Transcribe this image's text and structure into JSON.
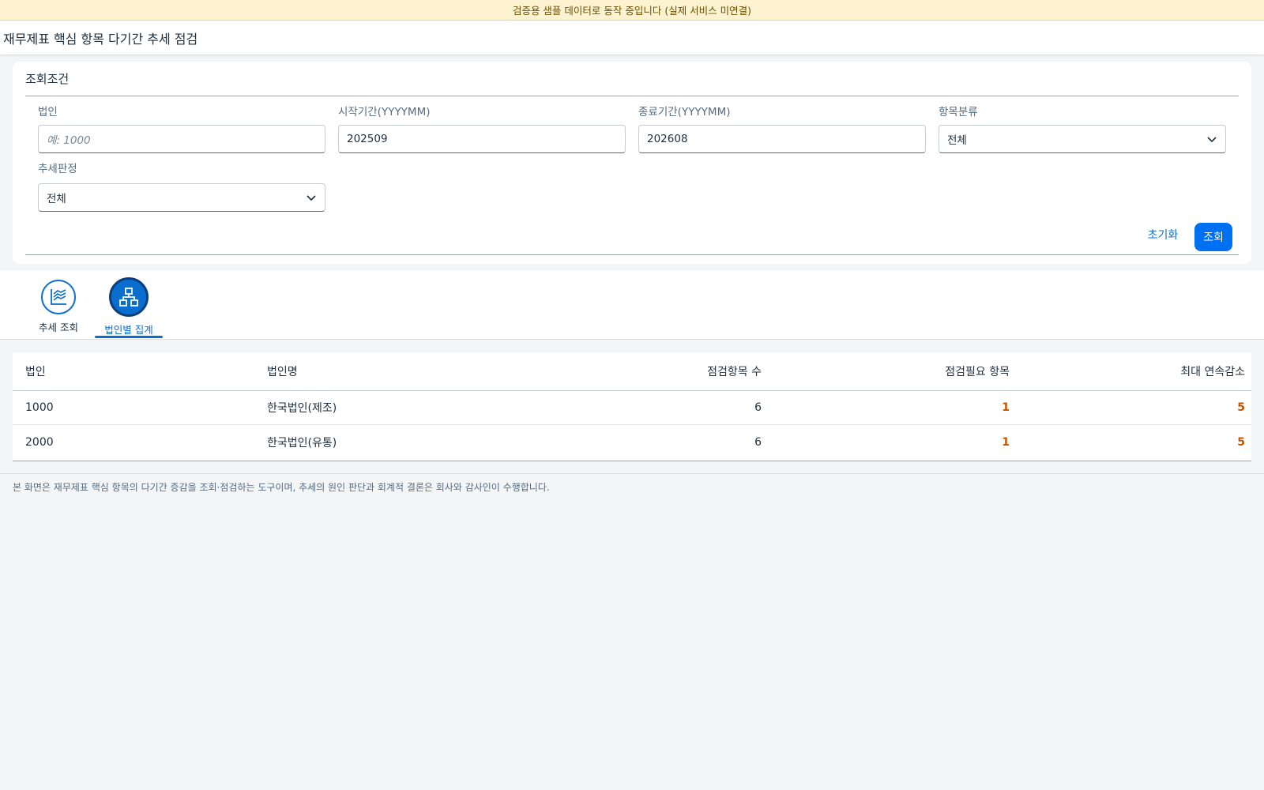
{
  "banner": {
    "text": "검증용 샘플 데이터로 동작 중입니다 (실제 서비스 미연결)"
  },
  "page": {
    "title": "재무제표 핵심 항목 다기간 추세 점검"
  },
  "filter": {
    "header": "조회조건",
    "entity": {
      "label": "법인",
      "value": "",
      "placeholder": "예: 1000"
    },
    "start_period": {
      "label": "시작기간(YYYYMM)",
      "value": "202509"
    },
    "end_period": {
      "label": "종료기간(YYYYMM)",
      "value": "202608"
    },
    "category": {
      "label": "항목분류",
      "value": "전체"
    },
    "trend_judgement": {
      "label": "추세판정",
      "value": "전체"
    },
    "reset_label": "초기화",
    "search_label": "조회"
  },
  "tabs": [
    {
      "label": "추세 조회",
      "icon": "line-chart-icon",
      "active": false
    },
    {
      "label": "법인별 집계",
      "icon": "org-hierarchy-icon",
      "active": true
    }
  ],
  "table": {
    "columns": [
      "법인",
      "법인명",
      "점검항목 수",
      "점검필요 항목",
      "최대 연속감소"
    ],
    "rows": [
      {
        "entity": "1000",
        "name": "한국법인(제조)",
        "check_items": "6",
        "need_check": "1",
        "max_decrease": "5"
      },
      {
        "entity": "2000",
        "name": "한국법인(유통)",
        "check_items": "6",
        "need_check": "1",
        "max_decrease": "5"
      }
    ]
  },
  "footer": {
    "note": "본 화면은 재무제표 핵심 항목의 다기간 증감을 조회·점검하는 도구이며, 추세의 원인 판단과 회계적 결론은 회사와 감사인이 수행합니다."
  },
  "colors": {
    "accent": "#0a6ed1",
    "primary_button": "#0070f2",
    "warning": "#c35500",
    "banner_bg": "#fdf3d0"
  }
}
